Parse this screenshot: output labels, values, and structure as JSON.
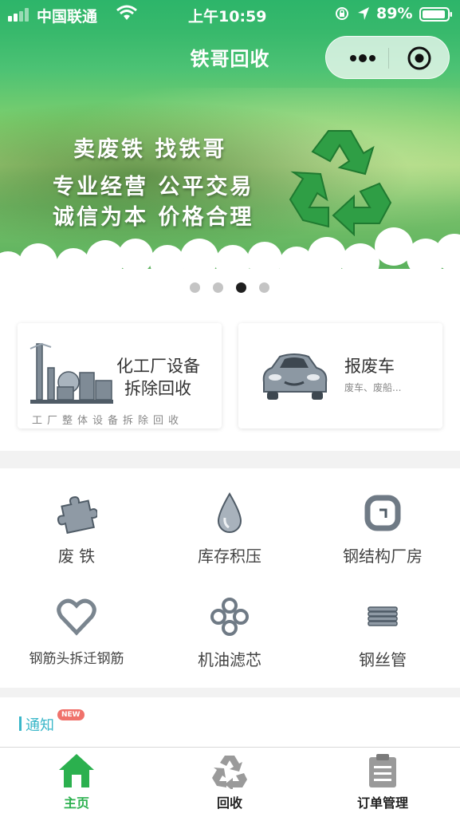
{
  "status_bar": {
    "carrier": "中国联通",
    "time": "上午10:59",
    "battery_pct": "89%",
    "icons": [
      "signal-icon",
      "wifi-icon",
      "orientation-lock-icon",
      "location-icon",
      "battery-icon"
    ]
  },
  "header": {
    "title": "铁哥回收",
    "capsule": {
      "icons": [
        "more-dots-icon",
        "close-target-icon"
      ]
    }
  },
  "banner": {
    "line1": "卖废铁 找铁哥",
    "line2": "专业经营  公平交易",
    "line3": "诚信为本  价格合理",
    "page_count": 4,
    "active_index": 2
  },
  "service_cards": [
    {
      "title_line1": "化工厂设备",
      "title_line2": "拆除回收",
      "subtitle": "工厂整体设备拆除回收",
      "icon": "factory-icon"
    },
    {
      "title_line1": "报废车",
      "subtitle": "废车、废船...",
      "icon": "car-icon"
    }
  ],
  "categories": [
    {
      "label": "废 铁",
      "icon": "puzzle-icon"
    },
    {
      "label": "库存积压",
      "icon": "drop-icon"
    },
    {
      "label": "钢结构厂房",
      "icon": "square-ring-icon"
    },
    {
      "label": "钢筋头拆迁钢筋",
      "icon": "heart-icon"
    },
    {
      "label": "机油滤芯",
      "icon": "clover-icon"
    },
    {
      "label": "钢丝管",
      "icon": "coil-icon"
    }
  ],
  "notice": {
    "label": "通知",
    "badge": "NEW"
  },
  "tabbar": [
    {
      "label": "主页",
      "icon": "home-icon",
      "active": true
    },
    {
      "label": "回收",
      "icon": "recycle-icon",
      "active": false
    },
    {
      "label": "订单管理",
      "icon": "clipboard-icon",
      "active": false
    }
  ],
  "colors": {
    "accent": "#2bb04e",
    "notice": "#3ab7c9",
    "badge": "#f0726b",
    "header_green": "#2db56a"
  }
}
